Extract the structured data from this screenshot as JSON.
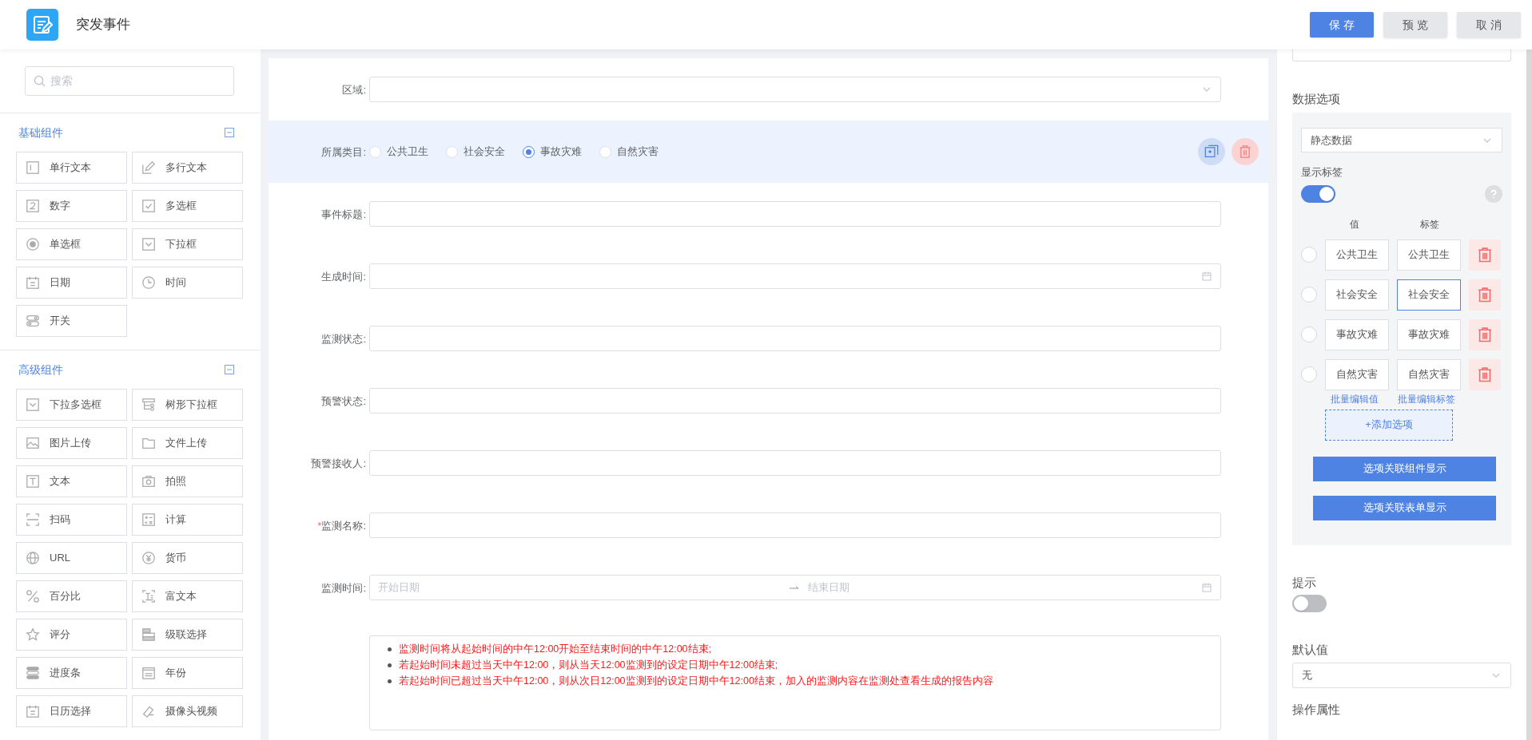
{
  "header": {
    "title": "突发事件",
    "buttons": [
      {
        "label": "保 存",
        "kind": "primary"
      },
      {
        "label": "预 览",
        "kind": "default"
      },
      {
        "label": "取 消",
        "kind": "default"
      }
    ]
  },
  "sidebar": {
    "search": {
      "placeholder": "搜索"
    },
    "groups": [
      {
        "title": "基础组件",
        "expanded": true,
        "items": [
          {
            "label": "单行文本",
            "kind": "textline"
          },
          {
            "label": "多行文本",
            "kind": "pencil"
          },
          {
            "label": "数字",
            "kind": "number"
          },
          {
            "label": "多选框",
            "kind": "checkbox"
          },
          {
            "label": "单选框",
            "kind": "radio"
          },
          {
            "label": "下拉框",
            "kind": "dropdown"
          },
          {
            "label": "日期",
            "kind": "calendar"
          },
          {
            "label": "时间",
            "kind": "clock"
          },
          {
            "label": "开关",
            "kind": "switch"
          }
        ]
      },
      {
        "title": "高级组件",
        "expanded": true,
        "items": [
          {
            "label": "下拉多选框",
            "kind": "dropdown"
          },
          {
            "label": "树形下拉框",
            "kind": "tree"
          },
          {
            "label": "图片上传",
            "kind": "image"
          },
          {
            "label": "文件上传",
            "kind": "folder"
          },
          {
            "label": "文本",
            "kind": "text"
          },
          {
            "label": "拍照",
            "kind": "camera"
          },
          {
            "label": "扫码",
            "kind": "scan"
          },
          {
            "label": "计算",
            "kind": "calc"
          },
          {
            "label": "URL",
            "kind": "globe"
          },
          {
            "label": "货币",
            "kind": "currency"
          },
          {
            "label": "百分比",
            "kind": "percent"
          },
          {
            "label": "富文本",
            "kind": "richtext"
          },
          {
            "label": "评分",
            "kind": "star"
          },
          {
            "label": "级联选择",
            "kind": "cascade"
          },
          {
            "label": "进度条",
            "kind": "progress"
          },
          {
            "label": "年份",
            "kind": "year"
          },
          {
            "label": "日历选择",
            "kind": "calendar"
          },
          {
            "label": "摄像头视频",
            "kind": "video"
          }
        ]
      }
    ]
  },
  "form": {
    "fields": [
      {
        "label": "区域:",
        "kind": "select",
        "selected": false
      },
      {
        "label": "所属类目:",
        "kind": "radio",
        "selected": true,
        "options": [
          {
            "label": "公共卫生",
            "selected": false
          },
          {
            "label": "社会安全",
            "selected": false
          },
          {
            "label": "事故灾难",
            "selected": true
          },
          {
            "label": "自然灾害",
            "selected": false
          }
        ]
      },
      {
        "label": "事件标题:",
        "kind": "input",
        "selected": false
      },
      {
        "label": "生成时间:",
        "kind": "date",
        "selected": false
      },
      {
        "label": "监测状态:",
        "kind": "input",
        "selected": false
      },
      {
        "label": "预警状态:",
        "kind": "input",
        "selected": false
      },
      {
        "label": "预警接收人:",
        "kind": "input",
        "selected": false
      },
      {
        "required_mark": "*",
        "label": "监测名称:",
        "kind": "input",
        "selected": false
      },
      {
        "label": "监测时间:",
        "kind": "daterange",
        "selected": false,
        "start_placeholder": "开始日期",
        "end_placeholder": "结束日期"
      },
      {
        "kind": "notes",
        "selected": false,
        "items": [
          "监测时间将从起始时间的中午12:00开始至结束时间的中午12:00结束;",
          "若起始时间未超过当天中午12:00，则从当天12:00监测到的设定日期中午12:00结束;",
          "若起始时间已超过当天中午12:00，则从次日12:00监测到的设定日期中午12:00结束，加入的监测内容在监测处查看生成的报告内容"
        ]
      }
    ]
  },
  "properties": {
    "data_options": {
      "title": "数据选项",
      "source": "静态数据",
      "show_labels": {
        "label": "显示标签",
        "on": true
      },
      "columns": [
        "值",
        "标签"
      ],
      "options": [
        {
          "value": "公共卫生",
          "label": "公共卫生",
          "selected": false,
          "label_focused": false
        },
        {
          "value": "社会安全",
          "label": "社会安全",
          "selected": false,
          "label_focused": true
        },
        {
          "value": "事故灾难",
          "label": "事故灾难",
          "selected": false,
          "label_focused": false
        },
        {
          "value": "自然灾害",
          "label": "自然灾害",
          "selected": false,
          "label_focused": false
        }
      ],
      "batch_links": [
        "批量编辑值",
        "批量编辑标签"
      ],
      "add_button": "+添加选项",
      "buttons": [
        "选项关联组件显示",
        "选项关联表单显示"
      ]
    },
    "hint": {
      "label": "提示",
      "on": false
    },
    "default_value": {
      "label": "默认值",
      "value": "无"
    },
    "next_section": "操作属性"
  }
}
